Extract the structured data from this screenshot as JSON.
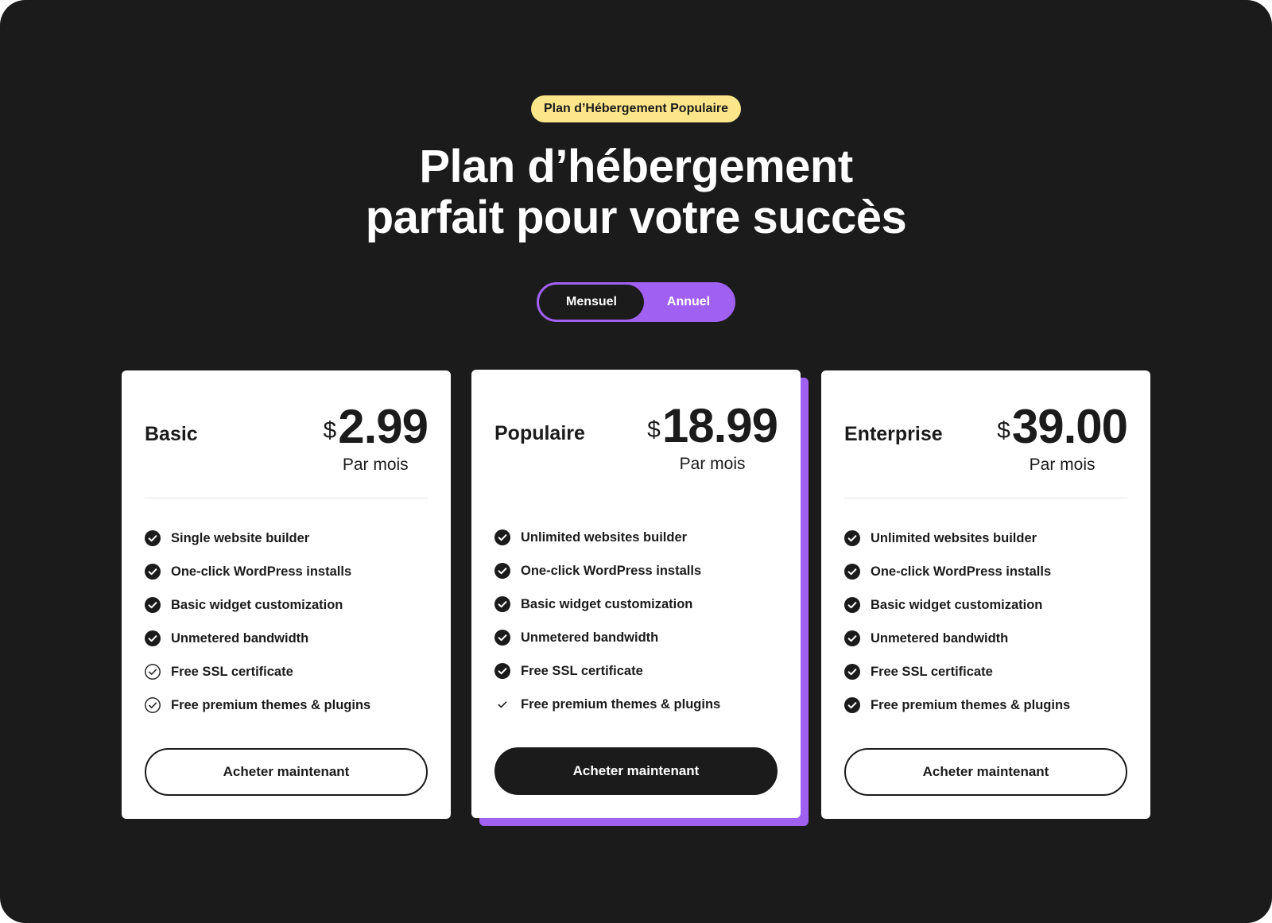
{
  "hero": {
    "badge": "Plan d’Hébergement Populaire",
    "title_line1": "Plan d’hébergement",
    "title_line2": "parfait pour votre succès"
  },
  "billing_toggle": {
    "options": [
      "Mensuel",
      "Annuel"
    ],
    "selected": "Mensuel"
  },
  "colors": {
    "background": "#1b1b1b",
    "accent": "#a061f2",
    "badge": "#fde68a",
    "card": "#ffffff"
  },
  "plans": [
    {
      "name": "Basic",
      "currency": "$",
      "price": "2.99",
      "period": "Par mois",
      "featured": false,
      "cta": "Acheter maintenant",
      "features": [
        {
          "label": "Single website builder",
          "icon": "check-circle-filled-icon"
        },
        {
          "label": "One-click WordPress installs",
          "icon": "check-circle-filled-icon"
        },
        {
          "label": "Basic widget customization",
          "icon": "check-circle-filled-icon"
        },
        {
          "label": "Unmetered bandwidth",
          "icon": "check-circle-filled-icon"
        },
        {
          "label": "Free SSL certificate",
          "icon": "check-circle-outline-icon"
        },
        {
          "label": "Free premium themes & plugins",
          "icon": "check-circle-outline-icon"
        }
      ]
    },
    {
      "name": "Populaire",
      "currency": "$",
      "price": "18.99",
      "period": "Par mois",
      "featured": true,
      "cta": "Acheter maintenant",
      "features": [
        {
          "label": "Unlimited websites builder",
          "icon": "check-circle-filled-icon"
        },
        {
          "label": "One-click WordPress installs",
          "icon": "check-circle-filled-icon"
        },
        {
          "label": "Basic widget customization",
          "icon": "check-circle-filled-icon"
        },
        {
          "label": "Unmetered bandwidth",
          "icon": "check-circle-filled-icon"
        },
        {
          "label": "Free SSL certificate",
          "icon": "check-circle-filled-icon"
        },
        {
          "label": "Free premium themes & plugins",
          "icon": "check-plain-icon"
        }
      ]
    },
    {
      "name": "Enterprise",
      "currency": "$",
      "price": "39.00",
      "period": "Par mois",
      "featured": false,
      "cta": "Acheter maintenant",
      "features": [
        {
          "label": "Unlimited websites builder",
          "icon": "check-circle-filled-icon"
        },
        {
          "label": "One-click WordPress installs",
          "icon": "check-circle-filled-icon"
        },
        {
          "label": "Basic widget customization",
          "icon": "check-circle-filled-icon"
        },
        {
          "label": "Unmetered bandwidth",
          "icon": "check-circle-filled-icon"
        },
        {
          "label": "Free SSL certificate",
          "icon": "check-circle-filled-icon"
        },
        {
          "label": "Free premium themes & plugins",
          "icon": "check-circle-filled-icon"
        }
      ]
    }
  ]
}
